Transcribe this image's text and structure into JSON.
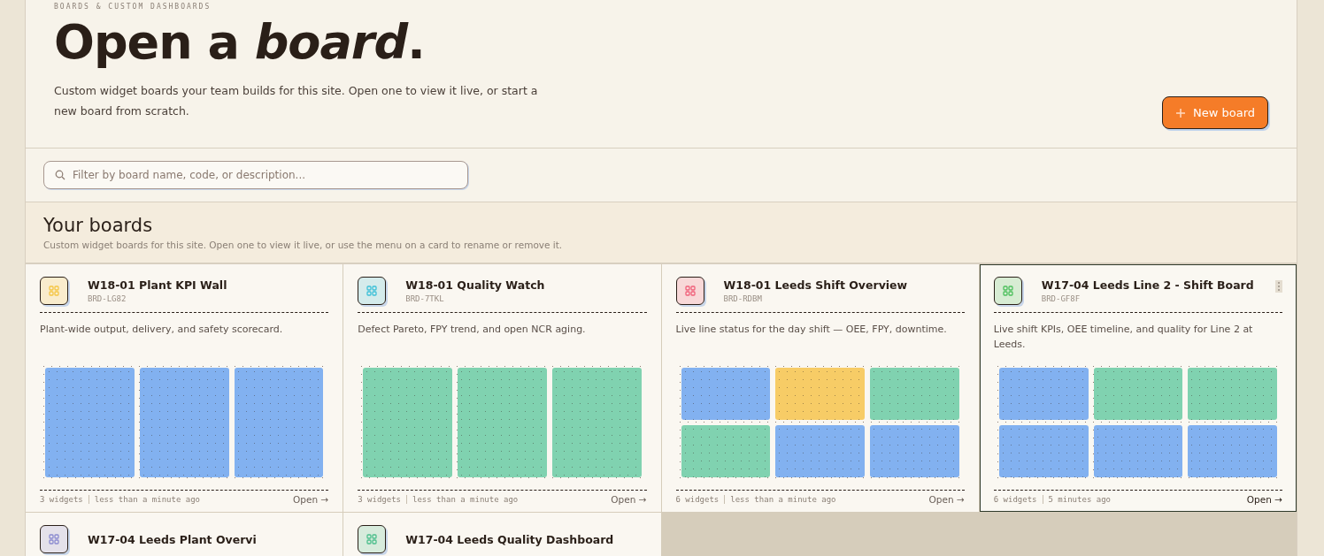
{
  "header": {
    "eyebrow": "BOARDS & CUSTOM DASHBOARDS",
    "title_plain": "Open a ",
    "title_italic": "board",
    "title_end": ".",
    "description": "Custom widget boards your team builds for this site. Open one to view it live, or start a new board from scratch.",
    "new_button": "New board"
  },
  "search": {
    "placeholder": "Filter by board name, code, or description..."
  },
  "section": {
    "title": "Your boards",
    "subtitle": "Custom widget boards for this site. Open one to view it live, or use the menu on a card to rename or remove it."
  },
  "boards": [
    {
      "title": "W18-01 Plant KPI Wall",
      "code": "BRD-LG82",
      "color": "#f5c542",
      "selected": false,
      "description": "Plant-wide output, delivery, and safety scorecard.",
      "widgets": [
        {
          "color": "#82b1f0"
        },
        {
          "color": "#82b1f0"
        },
        {
          "color": "#82b1f0"
        }
      ],
      "count": "3 widgets",
      "updated": "less than a minute ago",
      "open": "Open →"
    },
    {
      "title": "W18-01 Quality Watch",
      "code": "BRD-7TKL",
      "color": "#3cc0d8",
      "selected": false,
      "description": "Defect Pareto, FPY trend, and open NCR aging.",
      "widgets": [
        {
          "color": "#80d2b0"
        },
        {
          "color": "#80d2b0"
        },
        {
          "color": "#80d2b0"
        }
      ],
      "count": "3 widgets",
      "updated": "less than a minute ago",
      "open": "Open →"
    },
    {
      "title": "W18-01 Leeds Shift Overview",
      "code": "BRD-RDBM",
      "color": "#f0607a",
      "selected": false,
      "description": "Live line status for the day shift — OEE, FPY, downtime.",
      "widgets": [
        {
          "color": "#82b1f0"
        },
        {
          "color": "#f7cc66"
        },
        {
          "color": "#80d2b0"
        },
        {
          "color": "#80d2b0"
        },
        {
          "color": "#82b1f0"
        },
        {
          "color": "#82b1f0"
        }
      ],
      "count": "6 widgets",
      "updated": "less than a minute ago",
      "open": "Open →"
    },
    {
      "title": "W17-04 Leeds Line 2 - Shift Board",
      "code": "BRD-GF8F",
      "color": "#4cbf5c",
      "selected": true,
      "description": "Live shift KPIs, OEE timeline, and quality for Line 2 at Leeds.",
      "widgets": [
        {
          "color": "#82b1f0"
        },
        {
          "color": "#80d2b0"
        },
        {
          "color": "#80d2b0"
        },
        {
          "color": "#82b1f0"
        },
        {
          "color": "#82b1f0"
        },
        {
          "color": "#82b1f0"
        }
      ],
      "count": "6 widgets",
      "updated": "5 minutes ago",
      "open": "Open →"
    },
    {
      "title": "W17-04 Leeds Plant Overvi",
      "color": "#8a8ad0",
      "selected": false
    },
    {
      "title": "W17-04 Leeds Quality Dashboard",
      "color": "#4cbf8c",
      "selected": false
    }
  ]
}
